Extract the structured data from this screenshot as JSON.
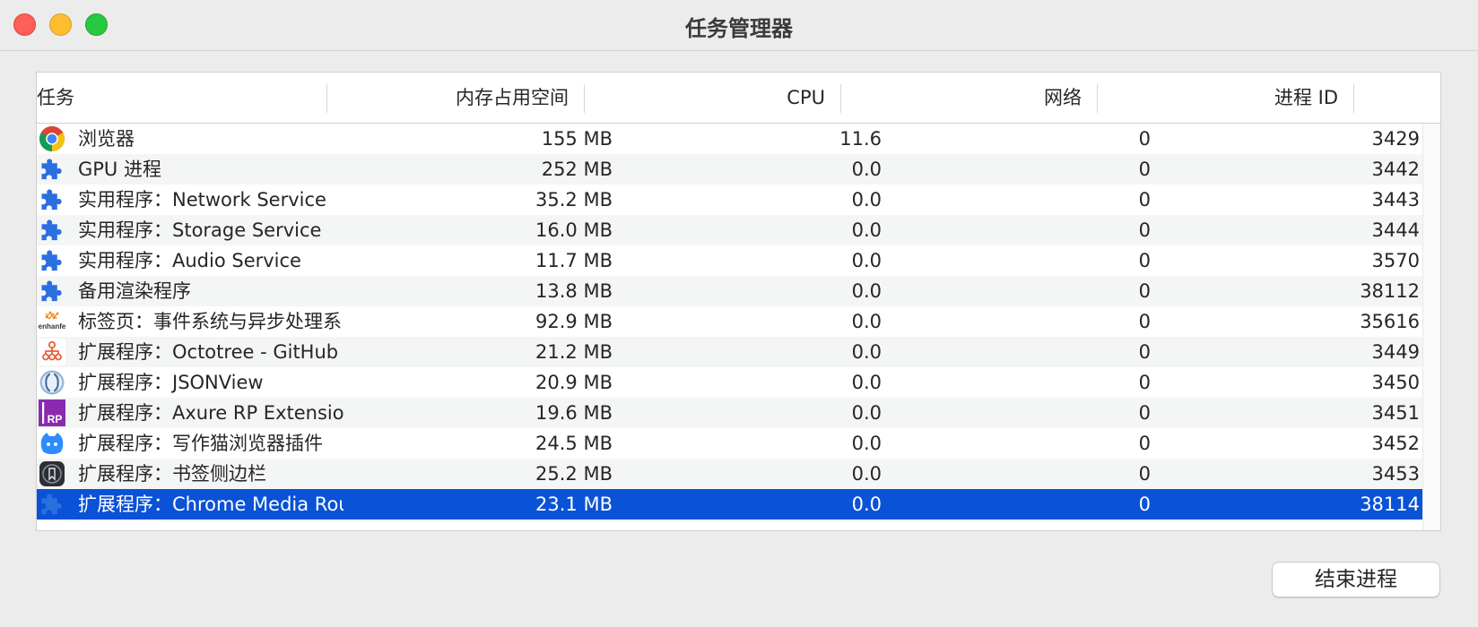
{
  "window": {
    "title": "任务管理器"
  },
  "table": {
    "columns": {
      "task": "任务",
      "memory": "内存占用空间",
      "cpu": "CPU",
      "network": "网络",
      "pid": "进程 ID"
    },
    "rows": [
      {
        "icon": "chrome-icon",
        "task": "浏览器",
        "memory": "155 MB",
        "cpu": "11.6",
        "network": "0",
        "pid": "3429"
      },
      {
        "icon": "puzzle-icon",
        "task": "GPU 进程",
        "memory": "252 MB",
        "cpu": "0.0",
        "network": "0",
        "pid": "3442"
      },
      {
        "icon": "puzzle-icon",
        "task": "实用程序：Network Service",
        "memory": "35.2 MB",
        "cpu": "0.0",
        "network": "0",
        "pid": "3443"
      },
      {
        "icon": "puzzle-icon",
        "task": "实用程序：Storage Service",
        "memory": "16.0 MB",
        "cpu": "0.0",
        "network": "0",
        "pid": "3444"
      },
      {
        "icon": "puzzle-icon",
        "task": "实用程序：Audio Service",
        "memory": "11.7 MB",
        "cpu": "0.0",
        "network": "0",
        "pid": "3570"
      },
      {
        "icon": "puzzle-icon",
        "task": "备用渲染程序",
        "memory": "13.8 MB",
        "cpu": "0.0",
        "network": "0",
        "pid": "38112"
      },
      {
        "icon": "enhanfe-icon",
        "icon_text": "enhanfe",
        "task": "标签页：事件系统与异步处理系",
        "memory": "92.9 MB",
        "cpu": "0.0",
        "network": "0",
        "pid": "35616"
      },
      {
        "icon": "octotree-icon",
        "task": "扩展程序：Octotree - GitHub",
        "memory": "21.2 MB",
        "cpu": "0.0",
        "network": "0",
        "pid": "3449"
      },
      {
        "icon": "jsonview-icon",
        "task": "扩展程序：JSONView",
        "memory": "20.9 MB",
        "cpu": "0.0",
        "network": "0",
        "pid": "3450"
      },
      {
        "icon": "axure-rp-icon",
        "icon_text": "RP",
        "task": "扩展程序：Axure RP Extension",
        "memory": "19.6 MB",
        "cpu": "0.0",
        "network": "0",
        "pid": "3451"
      },
      {
        "icon": "cat-icon",
        "task": "扩展程序：写作猫浏览器插件",
        "memory": "24.5 MB",
        "cpu": "0.0",
        "network": "0",
        "pid": "3452"
      },
      {
        "icon": "bookmark-sidebar-icon",
        "task": "扩展程序：书签侧边栏",
        "memory": "25.2 MB",
        "cpu": "0.0",
        "network": "0",
        "pid": "3453"
      },
      {
        "icon": "puzzle-icon",
        "task": "扩展程序：Chrome Media Router",
        "memory": "23.1 MB",
        "cpu": "0.0",
        "network": "0",
        "pid": "38114",
        "selected": true
      }
    ]
  },
  "footer": {
    "end_process_label": "结束进程"
  },
  "colors": {
    "selection": "#0a52d6",
    "row_alt": "#f4f5f5",
    "puzzle_blue": "#2a6fe0"
  }
}
